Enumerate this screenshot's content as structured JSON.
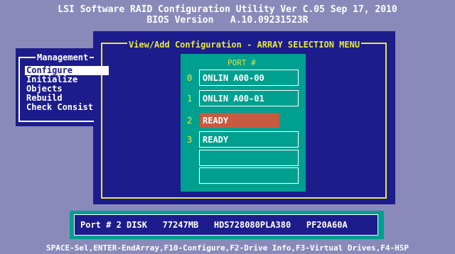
{
  "header": {
    "line1": "LSI Software RAID Configuration Utility Ver C.05 Sep 17, 2010",
    "line2": "BIOS Version   A.10.09231523R"
  },
  "management": {
    "title": "Management",
    "items": [
      "Configure",
      "Initialize",
      "Objects",
      "Rebuild",
      "Check Consist"
    ],
    "selected_index": 0
  },
  "array_menu": {
    "title": "View/Add Configuration - ARRAY SELECTION MENU",
    "port_header": "PORT #",
    "slots": [
      {
        "num": "0",
        "status": "ONLIN A00-00"
      },
      {
        "num": "1",
        "status": "ONLIN A00-01"
      },
      {
        "num": "2",
        "status": "READY"
      },
      {
        "num": "3",
        "status": "READY"
      },
      {
        "num": "",
        "status": ""
      },
      {
        "num": "",
        "status": ""
      }
    ],
    "highlighted_index": 2
  },
  "info": {
    "text": "Port # 2 DISK   77247MB   HDS728080PLA380   PF20A60A"
  },
  "footer": {
    "text": "SPACE-Sel,ENTER-EndArray,F10-Configure,F2-Drive Info,F3-Virtual Drives,F4-HSP"
  },
  "colors": {
    "background": "#8a8aba",
    "panel": "#1c1c8c",
    "teal": "#00a090",
    "title_yellow": "#e8e840",
    "highlight": "#c85a40"
  }
}
